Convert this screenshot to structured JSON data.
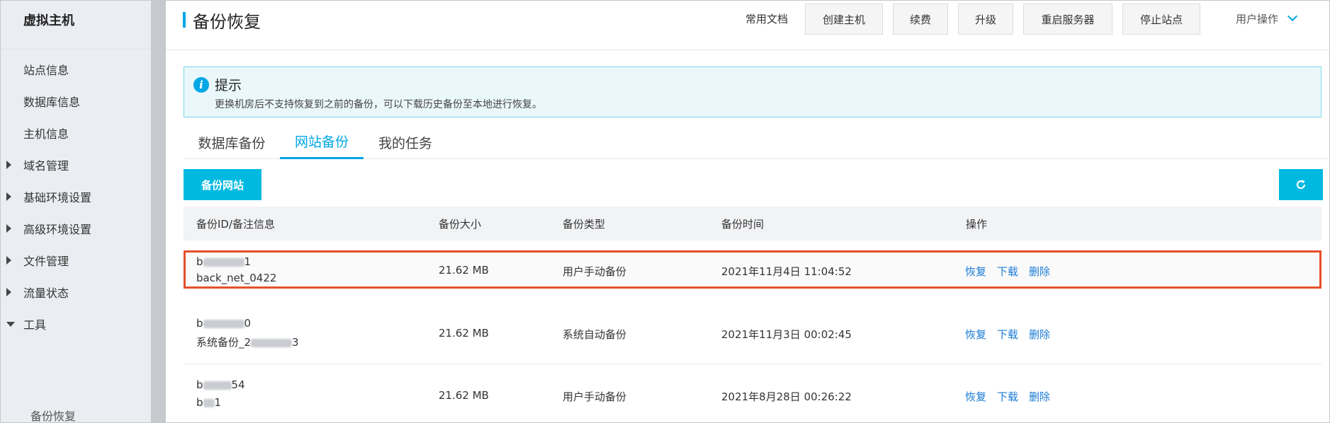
{
  "sidebar": {
    "title": "虚拟主机",
    "items": [
      {
        "label": "站点信息",
        "caret": "none"
      },
      {
        "label": "数据库信息",
        "caret": "none"
      },
      {
        "label": "主机信息",
        "caret": "none"
      },
      {
        "label": "域名管理",
        "caret": "right"
      },
      {
        "label": "基础环境设置",
        "caret": "right"
      },
      {
        "label": "高级环境设置",
        "caret": "right"
      },
      {
        "label": "文件管理",
        "caret": "right"
      },
      {
        "label": "流量状态",
        "caret": "right"
      },
      {
        "label": "工具",
        "caret": "down"
      }
    ],
    "sub_item": "备份恢复"
  },
  "header": {
    "title": "备份恢复",
    "docs_link": "常用文档",
    "buttons": [
      "创建主机",
      "续费",
      "升级",
      "重启服务器",
      "停止站点"
    ],
    "user_ops": "用户操作"
  },
  "tip": {
    "title": "提示",
    "text": "更换机房后不支持恢复到之前的备份，可以下载历史备份至本地进行恢复。"
  },
  "tabs": [
    "数据库备份",
    "网站备份",
    "我的任务"
  ],
  "active_tab": "网站备份",
  "toolbar": {
    "backup_button": "备份网站"
  },
  "table": {
    "headers": [
      "备份ID/备注信息",
      "备份大小",
      "备份类型",
      "备份时间",
      "操作"
    ],
    "rows": [
      {
        "id_prefix": "b",
        "id_suffix": "1",
        "note": "back_net_0422",
        "note_blurred": false,
        "note_suffix": "",
        "size": "21.62 MB",
        "type": "用户手动备份",
        "time": "2021年11月4日 11:04:52",
        "highlighted": true
      },
      {
        "id_prefix": "b",
        "id_suffix": "0",
        "note": "系统备份_2",
        "note_blurred": true,
        "note_suffix": "3",
        "size": "21.62 MB",
        "type": "系统自动备份",
        "time": "2021年11月3日 00:02:45",
        "highlighted": false
      },
      {
        "id_prefix": "b",
        "id_suffix": "54",
        "note": "b",
        "note_blurred": true,
        "note_suffix": "1",
        "size": "21.62 MB",
        "type": "用户手动备份",
        "time": "2021年8月28日 00:26:22",
        "highlighted": false
      }
    ],
    "actions": [
      "恢复",
      "下载",
      "删除"
    ]
  },
  "colors": {
    "accent": "#00a7e5",
    "highlight_border": "#e4502a",
    "link": "#1a7bd6"
  }
}
